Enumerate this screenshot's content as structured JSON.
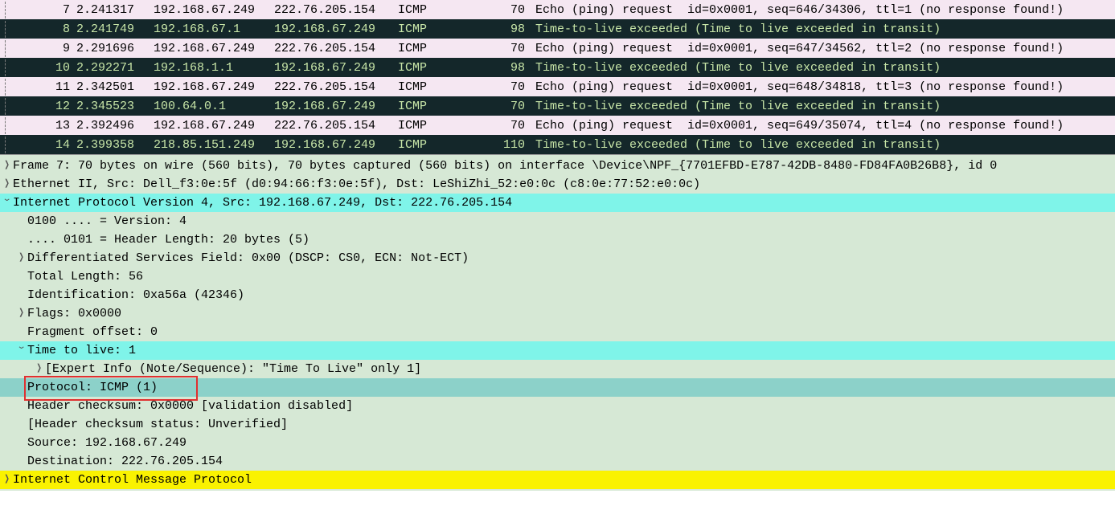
{
  "packets": [
    {
      "no": "7",
      "time": "2.241317",
      "src": "192.168.67.249",
      "dst": "222.76.205.154",
      "proto": "ICMP",
      "len": "70",
      "info": "Echo (ping) request  id=0x0001, seq=646/34306, ttl=1 (no response found!)",
      "cls": "row-light"
    },
    {
      "no": "8",
      "time": "2.241749",
      "src": "192.168.67.1",
      "dst": "192.168.67.249",
      "proto": "ICMP",
      "len": "98",
      "info": "Time-to-live exceeded (Time to live exceeded in transit)",
      "cls": "row-dark"
    },
    {
      "no": "9",
      "time": "2.291696",
      "src": "192.168.67.249",
      "dst": "222.76.205.154",
      "proto": "ICMP",
      "len": "70",
      "info": "Echo (ping) request  id=0x0001, seq=647/34562, ttl=2 (no response found!)",
      "cls": "row-light"
    },
    {
      "no": "10",
      "time": "2.292271",
      "src": "192.168.1.1",
      "dst": "192.168.67.249",
      "proto": "ICMP",
      "len": "98",
      "info": "Time-to-live exceeded (Time to live exceeded in transit)",
      "cls": "row-dark"
    },
    {
      "no": "11",
      "time": "2.342501",
      "src": "192.168.67.249",
      "dst": "222.76.205.154",
      "proto": "ICMP",
      "len": "70",
      "info": "Echo (ping) request  id=0x0001, seq=648/34818, ttl=3 (no response found!)",
      "cls": "row-light"
    },
    {
      "no": "12",
      "time": "2.345523",
      "src": "100.64.0.1",
      "dst": "192.168.67.249",
      "proto": "ICMP",
      "len": "70",
      "info": "Time-to-live exceeded (Time to live exceeded in transit)",
      "cls": "row-dark"
    },
    {
      "no": "13",
      "time": "2.392496",
      "src": "192.168.67.249",
      "dst": "222.76.205.154",
      "proto": "ICMP",
      "len": "70",
      "info": "Echo (ping) request  id=0x0001, seq=649/35074, ttl=4 (no response found!)",
      "cls": "row-light"
    },
    {
      "no": "14",
      "time": "2.399358",
      "src": "218.85.151.249",
      "dst": "192.168.67.249",
      "proto": "ICMP",
      "len": "110",
      "info": "Time-to-live exceeded (Time to live exceeded in transit)",
      "cls": "row-dark"
    }
  ],
  "details": {
    "frame": "Frame 7: 70 bytes on wire (560 bits), 70 bytes captured (560 bits) on interface \\Device\\NPF_{7701EFBD-E787-42DB-8480-FD84FA0B26B8}, id 0",
    "eth": "Ethernet II, Src: Dell_f3:0e:5f (d0:94:66:f3:0e:5f), Dst: LeShiZhi_52:e0:0c (c8:0e:77:52:e0:0c)",
    "ip": "Internet Protocol Version 4, Src: 192.168.67.249, Dst: 222.76.205.154",
    "ip_version": "0100 .... = Version: 4",
    "ip_hdrlen": ".... 0101 = Header Length: 20 bytes (5)",
    "ip_dsf": "Differentiated Services Field: 0x00 (DSCP: CS0, ECN: Not-ECT)",
    "ip_totlen": "Total Length: 56",
    "ip_id": "Identification: 0xa56a (42346)",
    "ip_flags": "Flags: 0x0000",
    "ip_frag": "Fragment offset: 0",
    "ip_ttl": "Time to live: 1",
    "ip_ttl_expert": "[Expert Info (Note/Sequence): \"Time To Live\" only 1]",
    "ip_proto": "Protocol: ICMP (1)",
    "ip_chksum": "Header checksum: 0x0000 [validation disabled]",
    "ip_chkstat": "[Header checksum status: Unverified]",
    "ip_src": "Source: 192.168.67.249",
    "ip_dst": "Destination: 222.76.205.154",
    "icmp": "Internet Control Message Protocol"
  }
}
